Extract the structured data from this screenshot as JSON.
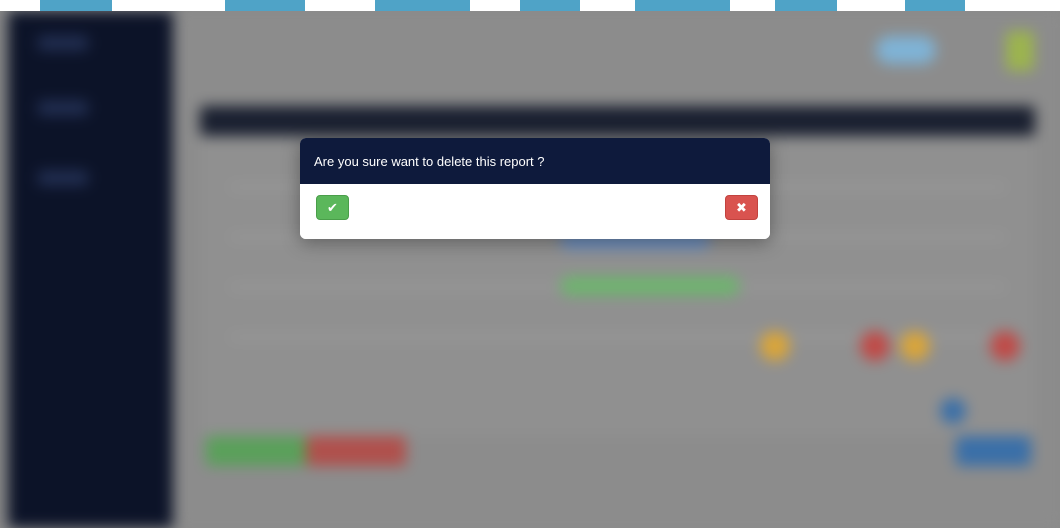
{
  "modal": {
    "title": "Are you sure want to delete this report ?",
    "confirm_icon": "check-icon",
    "cancel_icon": "close-icon",
    "confirm_glyph": "✔",
    "cancel_glyph": "✖",
    "confirm_color": "#5bb75b",
    "cancel_color": "#d9534f",
    "header_color": "#0e1a3c"
  },
  "background": {
    "sidebar_color": "#0c1328",
    "overlay_color": "#8a8a8a",
    "watermark_color": "#4fa3c7"
  }
}
